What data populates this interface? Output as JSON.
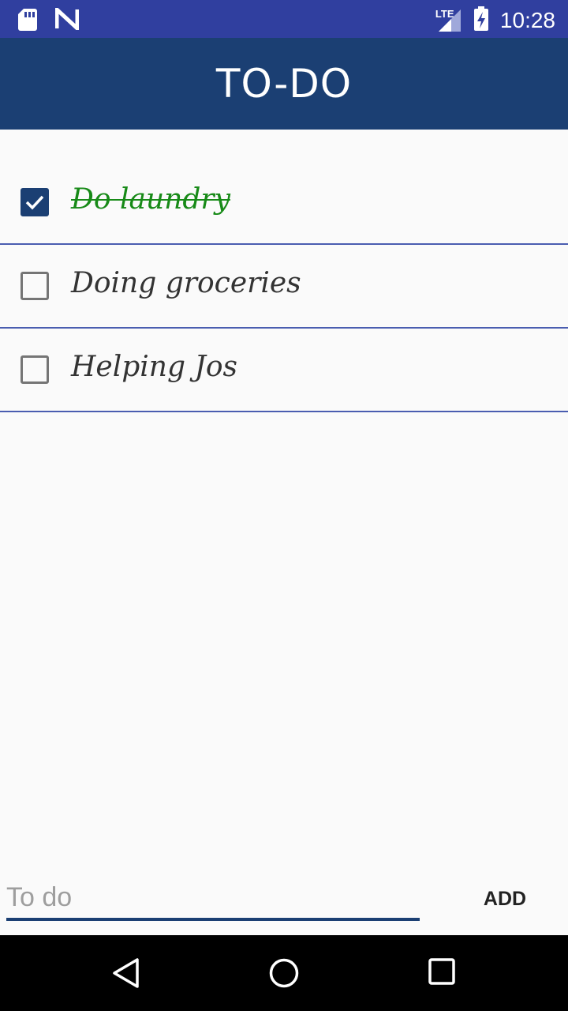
{
  "status_bar": {
    "network": "LTE",
    "time": "10:28",
    "icons": [
      "sd-card-icon",
      "n-notification-icon",
      "signal-icon",
      "battery-charging-icon"
    ]
  },
  "app_bar": {
    "title": "TO-DO"
  },
  "todos": [
    {
      "text": "Do laundry",
      "checked": true
    },
    {
      "text": "Doing groceries",
      "checked": false
    },
    {
      "text": "Helping Jos",
      "checked": false
    }
  ],
  "input": {
    "placeholder": "To do",
    "value": ""
  },
  "add_button": {
    "label": "ADD"
  },
  "nav_bar": {
    "icons": [
      "back-icon",
      "home-icon",
      "recents-icon"
    ]
  },
  "colors": {
    "status_bar": "#303f9f",
    "app_bar": "#1b3f73",
    "done_text": "#178a17",
    "divider": "#4a5db0"
  }
}
